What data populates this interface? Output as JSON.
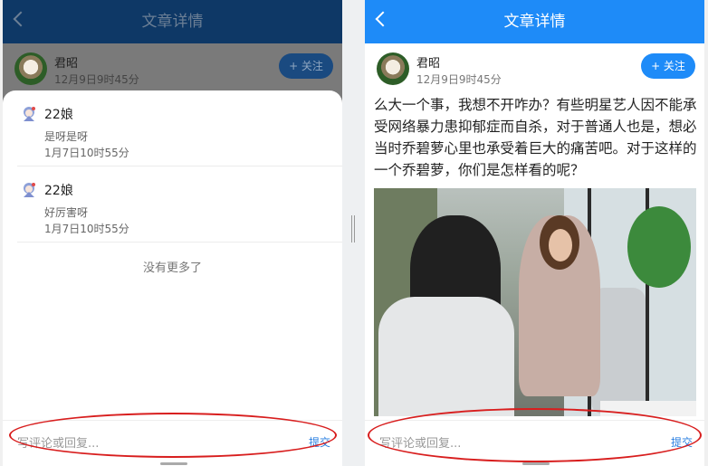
{
  "colors": {
    "accent": "#1e8bf8",
    "annotation": "#d81e1e"
  },
  "left": {
    "header_title": "文章详情",
    "author": {
      "name": "君昭",
      "time": "12月9日9时45分",
      "follow_label": "+ 关注"
    },
    "comments": [
      {
        "name": "22娘",
        "text": "是呀是呀",
        "time": "1月7日10时55分"
      },
      {
        "name": "22娘",
        "text": "好厉害呀",
        "time": "1月7日10时55分"
      }
    ],
    "no_more": "没有更多了",
    "input_placeholder": "写评论或回复...",
    "submit_label": "提交"
  },
  "right": {
    "header_title": "文章详情",
    "author": {
      "name": "君昭",
      "time": "12月9日9时45分",
      "follow_label": "+ 关注"
    },
    "article_text": "么大一个事，我想不开咋办？有些明星艺人因不能承受网络暴力患抑郁症而自杀，对于普通人也是，想必当时乔碧萝心里也承受着巨大的痛苦吧。对于这样的一个乔碧萝，你们是怎样看的呢？",
    "input_placeholder": "写评论或回复...",
    "submit_label": "提交"
  }
}
